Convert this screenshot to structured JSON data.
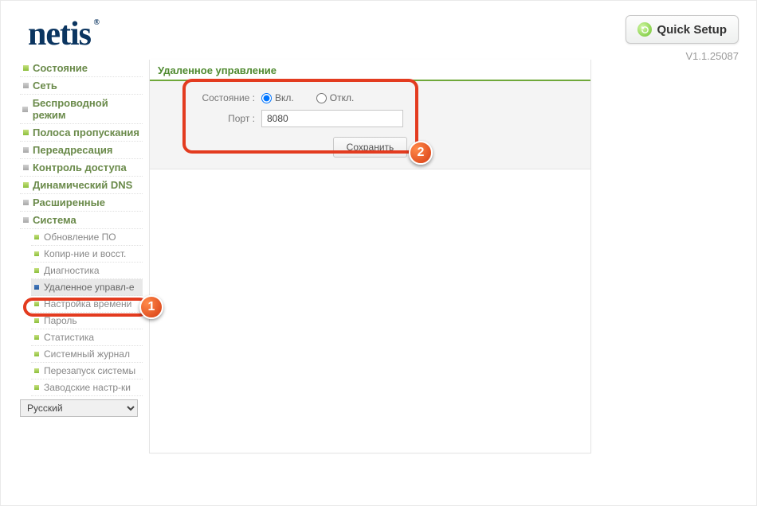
{
  "header": {
    "logo": "netis",
    "quick_setup": "Quick Setup",
    "version": "V1.1.25087"
  },
  "sidebar": {
    "items": [
      {
        "label": "Состояние",
        "gray": false
      },
      {
        "label": "Сеть",
        "gray": true
      },
      {
        "label": "Беспроводной режим",
        "gray": true
      },
      {
        "label": "Полоса пропускания",
        "gray": false
      },
      {
        "label": "Переадресация",
        "gray": true
      },
      {
        "label": "Контроль доступа",
        "gray": true
      },
      {
        "label": "Динамический DNS",
        "gray": false
      },
      {
        "label": "Расширенные",
        "gray": true
      },
      {
        "label": "Система",
        "gray": true
      }
    ],
    "sub": [
      {
        "label": "Обновление ПО"
      },
      {
        "label": "Копир-ние и восст."
      },
      {
        "label": "Диагностика"
      },
      {
        "label": "Удаленное управл-е"
      },
      {
        "label": "Настройка времени"
      },
      {
        "label": "Пароль"
      },
      {
        "label": "Статистика"
      },
      {
        "label": "Системный журнал"
      },
      {
        "label": "Перезапуск системы"
      },
      {
        "label": "Заводские настр-ки"
      }
    ],
    "language": "Русский"
  },
  "page": {
    "title": "Удаленное управление",
    "state_label": "Состояние :",
    "state_on": "Вкл.",
    "state_off": "Откл.",
    "port_label": "Порт :",
    "port_value": "8080",
    "save": "Сохранить"
  },
  "badges": {
    "one": "1",
    "two": "2"
  }
}
